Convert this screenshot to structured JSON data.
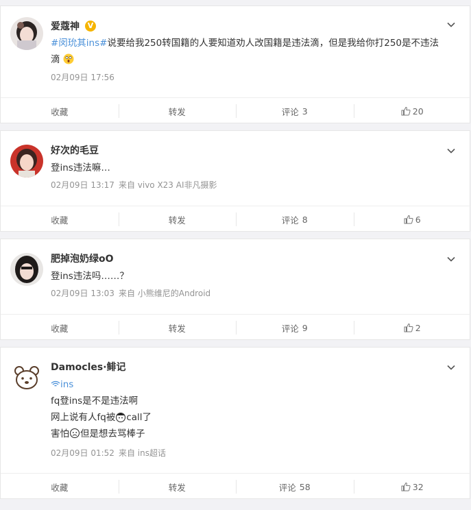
{
  "posts": [
    {
      "author": "爱蔻神",
      "verified_badge": "V",
      "topic": "#闵玧其ins#",
      "text_line1": "说要给我250转国籍的人要知道劝人改国籍是违法滴，但是我给你打250是不违法",
      "text_line2": "滴",
      "time": "02月09日 17:56",
      "source": "",
      "actions": {
        "favorite": "收藏",
        "repost": "转发",
        "comment": "评论",
        "comment_count": "3",
        "likes": "20"
      }
    },
    {
      "author": "好次的毛豆",
      "text_line1": "登ins违法嘛…",
      "time": "02月09日 13:17",
      "source": "来自 vivo X23 AI非凡摄影",
      "actions": {
        "favorite": "收藏",
        "repost": "转发",
        "comment": "评论",
        "comment_count": "8",
        "likes": "6"
      }
    },
    {
      "author": "肥掉泡奶绿oO",
      "text_line1": "登ins违法吗……？",
      "time": "02月09日 13:03",
      "source": "来自 小熊维尼的Android",
      "actions": {
        "favorite": "收藏",
        "repost": "转发",
        "comment": "评论",
        "comment_count": "9",
        "likes": "2"
      }
    },
    {
      "author": "Damocles·鲱记",
      "topic_link": "ins",
      "text_line1": "fq登ins是不是违法啊",
      "text_line2a": "网上说有人fq被",
      "text_line2b": "call了",
      "text_line3a": "害怕",
      "text_line3b": "但是想去骂棒子",
      "time": "02月09日 01:52",
      "source": "来自 ins超话",
      "actions": {
        "favorite": "收藏",
        "repost": "转发",
        "comment": "评论",
        "comment_count": "58",
        "likes": "32"
      }
    }
  ],
  "icons": {
    "chevron": "chevron-down-icon",
    "like": "thumbs-up-icon",
    "link": "link-icon"
  },
  "colors": {
    "topic": "#4a90d9",
    "meta": "#939393",
    "badge": "#f5b400"
  }
}
